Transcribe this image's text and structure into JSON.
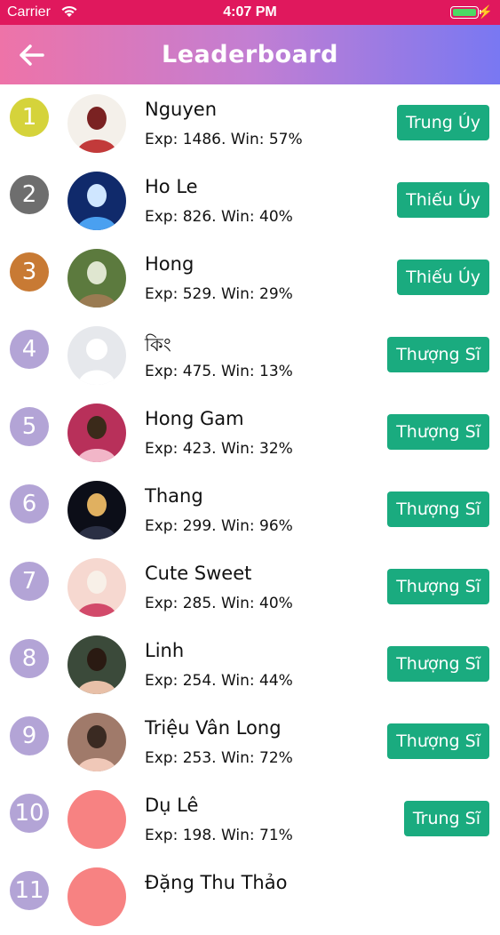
{
  "status_bar": {
    "carrier": "Carrier",
    "time": "4:07 PM"
  },
  "header": {
    "title": "Leaderboard"
  },
  "colors": {
    "status_bar": "#e0185d",
    "badge": "#1aab7f",
    "rank_gold": "#d5d33b",
    "rank_silver": "#6e6e6e",
    "rank_bronze": "#c87a34",
    "rank_other": "#b3a4d6"
  },
  "players": [
    {
      "rank": "1",
      "name": "Nguyen",
      "exp": "Exp: 1486. Win: 57%",
      "title": "Trung Úy",
      "rank_color": "#d5d33b",
      "avatar": "photo"
    },
    {
      "rank": "2",
      "name": "Ho Le",
      "exp": "Exp: 826. Win: 40%",
      "title": "Thiếu Úy",
      "rank_color": "#6e6e6e",
      "avatar": "photo"
    },
    {
      "rank": "3",
      "name": "Hong",
      "exp": "Exp: 529. Win: 29%",
      "title": "Thiếu Úy",
      "rank_color": "#c87a34",
      "avatar": "photo"
    },
    {
      "rank": "4",
      "name": "কিং",
      "exp": "Exp: 475. Win: 13%",
      "title": "Thượng Sĩ",
      "rank_color": "#b3a4d6",
      "avatar": "default"
    },
    {
      "rank": "5",
      "name": "Hong Gam",
      "exp": "Exp: 423. Win: 32%",
      "title": "Thượng Sĩ",
      "rank_color": "#b3a4d6",
      "avatar": "photo"
    },
    {
      "rank": "6",
      "name": "Thang",
      "exp": "Exp: 299. Win: 96%",
      "title": "Thượng Sĩ",
      "rank_color": "#b3a4d6",
      "avatar": "photo"
    },
    {
      "rank": "7",
      "name": "Cute Sweet",
      "exp": "Exp: 285. Win: 40%",
      "title": "Thượng Sĩ",
      "rank_color": "#b3a4d6",
      "avatar": "photo"
    },
    {
      "rank": "8",
      "name": "Linh",
      "exp": "Exp: 254. Win: 44%",
      "title": "Thượng Sĩ",
      "rank_color": "#b3a4d6",
      "avatar": "photo"
    },
    {
      "rank": "9",
      "name": "Triệu Vân Long",
      "exp": "Exp: 253. Win: 72%",
      "title": "Thượng Sĩ",
      "rank_color": "#b3a4d6",
      "avatar": "photo"
    },
    {
      "rank": "10",
      "name": "Dụ Lê",
      "exp": "Exp: 198. Win: 71%",
      "title": "Trung Sĩ",
      "rank_color": "#b3a4d6",
      "avatar": "blank"
    },
    {
      "rank": "11",
      "name": "Đặng Thu Thảo",
      "exp": "",
      "title": "",
      "rank_color": "#b3a4d6",
      "avatar": "blank"
    }
  ]
}
